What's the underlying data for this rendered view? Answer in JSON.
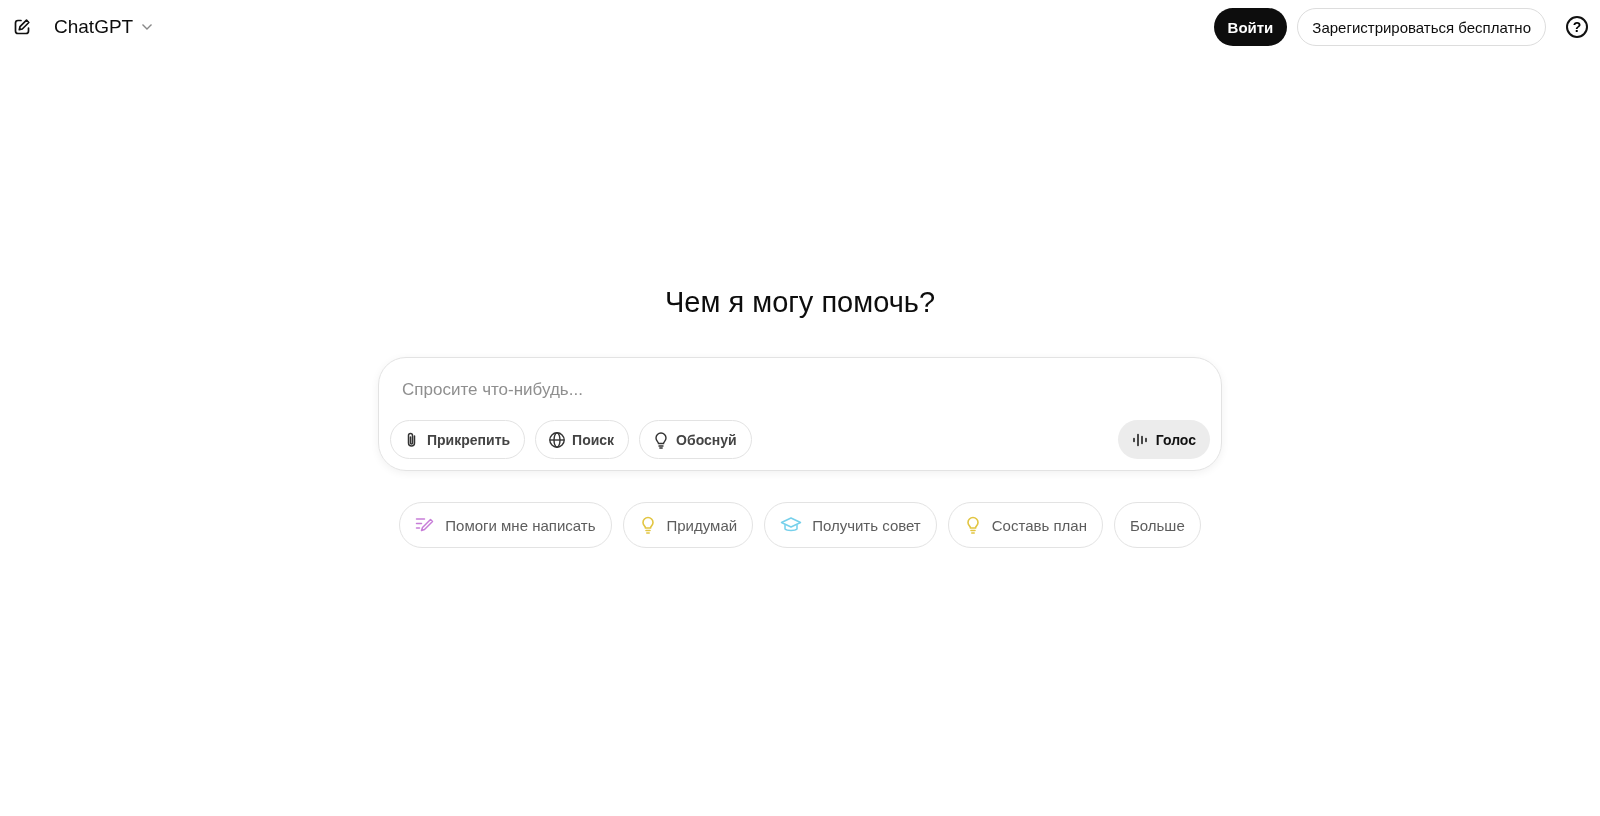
{
  "header": {
    "model": "ChatGPT",
    "login": "Войти",
    "signup": "Зарегистрироваться бесплатно",
    "help": "?"
  },
  "heading": "Чем я могу помочь?",
  "composer": {
    "placeholder": "Спросите что-нибудь...",
    "tools": [
      {
        "kind": "attach",
        "label": "Прикрепить"
      },
      {
        "kind": "search",
        "label": "Поиск"
      },
      {
        "kind": "reason",
        "label": "Обоснуй"
      }
    ],
    "voice": "Голос"
  },
  "suggestions": [
    {
      "kind": "pen",
      "label": "Помоги мне написать",
      "color": "#c77dd8"
    },
    {
      "kind": "bulb",
      "label": "Придумай",
      "color": "#e2c541"
    },
    {
      "kind": "cap",
      "label": "Получить совет",
      "color": "#76d0eb"
    },
    {
      "kind": "bulb",
      "label": "Составь план",
      "color": "#e2c541"
    },
    {
      "kind": "none",
      "label": "Больше"
    }
  ]
}
